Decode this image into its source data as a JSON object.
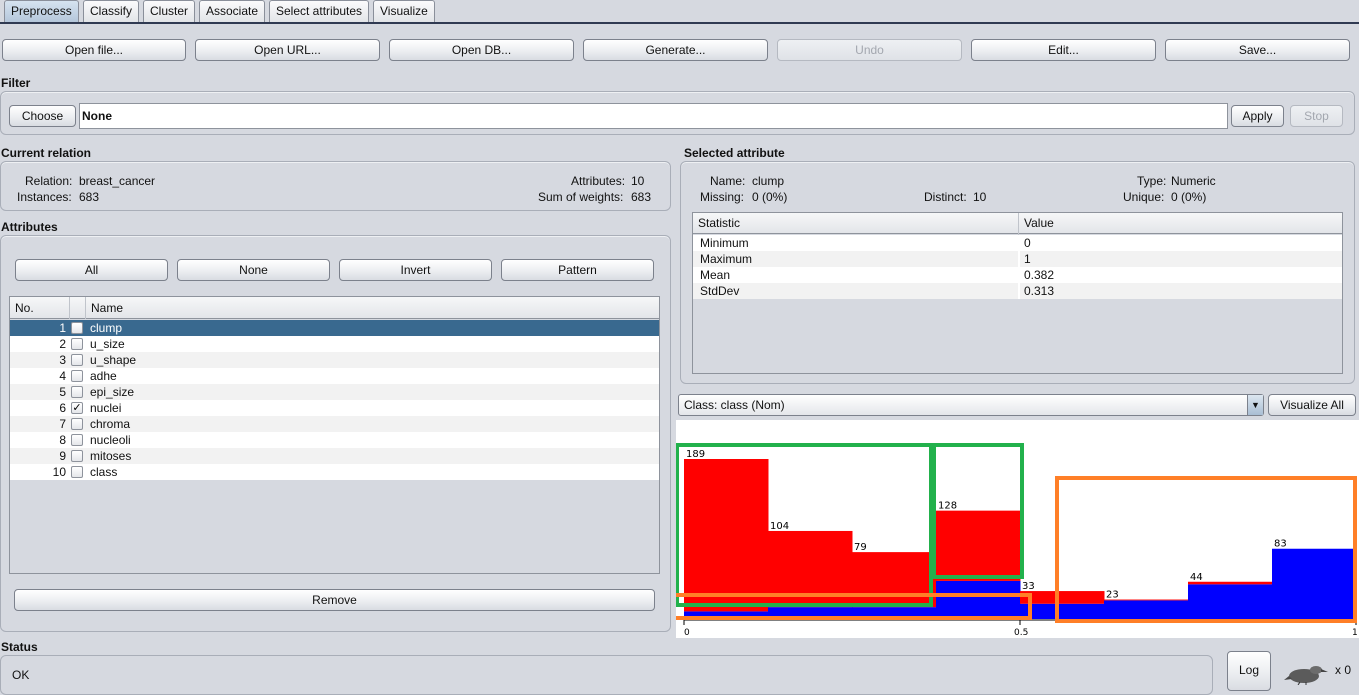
{
  "tabs": [
    "Preprocess",
    "Classify",
    "Cluster",
    "Associate",
    "Select attributes",
    "Visualize"
  ],
  "active_tab": "Preprocess",
  "toolbar": {
    "open_file": "Open file...",
    "open_url": "Open URL...",
    "open_db": "Open DB...",
    "generate": "Generate...",
    "undo": "Undo",
    "edit": "Edit...",
    "save": "Save..."
  },
  "filter": {
    "title": "Filter",
    "choose": "Choose",
    "value": "None",
    "apply": "Apply",
    "stop": "Stop"
  },
  "current_relation": {
    "title": "Current relation",
    "relation_label": "Relation:",
    "relation": "breast_cancer",
    "instances_label": "Instances:",
    "instances": "683",
    "attributes_label": "Attributes:",
    "attributes": "10",
    "sum_weights_label": "Sum of weights:",
    "sum_weights": "683"
  },
  "attributes": {
    "title": "Attributes",
    "buttons": {
      "all": "All",
      "none": "None",
      "invert": "Invert",
      "pattern": "Pattern"
    },
    "col_no": "No.",
    "col_name": "Name",
    "rows": [
      {
        "no": "1",
        "name": "clump",
        "checked": false,
        "selected": true
      },
      {
        "no": "2",
        "name": "u_size",
        "checked": false,
        "selected": false
      },
      {
        "no": "3",
        "name": "u_shape",
        "checked": false,
        "selected": false
      },
      {
        "no": "4",
        "name": "adhe",
        "checked": false,
        "selected": false
      },
      {
        "no": "5",
        "name": "epi_size",
        "checked": false,
        "selected": false
      },
      {
        "no": "6",
        "name": "nuclei",
        "checked": true,
        "selected": false
      },
      {
        "no": "7",
        "name": "chroma",
        "checked": false,
        "selected": false
      },
      {
        "no": "8",
        "name": "nucleoli",
        "checked": false,
        "selected": false
      },
      {
        "no": "9",
        "name": "mitoses",
        "checked": false,
        "selected": false
      },
      {
        "no": "10",
        "name": "class",
        "checked": false,
        "selected": false
      }
    ],
    "remove": "Remove"
  },
  "selected_attribute": {
    "title": "Selected attribute",
    "name_label": "Name:",
    "name": "clump",
    "type_label": "Type:",
    "type": "Numeric",
    "missing_label": "Missing:",
    "missing": "0 (0%)",
    "distinct_label": "Distinct:",
    "distinct": "10",
    "unique_label": "Unique:",
    "unique": "0 (0%)",
    "col_statistic": "Statistic",
    "col_value": "Value",
    "stats": [
      {
        "statistic": "Minimum",
        "value": "0"
      },
      {
        "statistic": "Maximum",
        "value": "1"
      },
      {
        "statistic": "Mean",
        "value": "0.382"
      },
      {
        "statistic": "StdDev",
        "value": "0.313"
      }
    ]
  },
  "class_selector": {
    "value": "Class: class (Nom)",
    "arrow": "▼"
  },
  "visualize_all": "Visualize All",
  "histogram": {
    "colors": {
      "class_a": "#ff0000",
      "class_b": "#0000ff"
    },
    "x_ticks": [
      "0",
      "0.5",
      "1"
    ],
    "bins": [
      {
        "total": 189,
        "red": 180,
        "blue": 9
      },
      {
        "total": 104,
        "red": 90,
        "blue": 14
      },
      {
        "total": 79,
        "red": 65,
        "blue": 14
      },
      {
        "total": 128,
        "red": 83,
        "blue": 45
      },
      {
        "total": 33,
        "red": 15,
        "blue": 18
      },
      {
        "total": 23,
        "red": 1,
        "blue": 22
      },
      {
        "total": 44,
        "red": 3,
        "blue": 41
      },
      {
        "total": 83,
        "red": 0,
        "blue": 83
      }
    ],
    "annotation_colors": {
      "green": "#22b14c",
      "orange": "#ff7f27"
    }
  },
  "status": {
    "title": "Status",
    "text": "OK",
    "log": "Log",
    "count": "x 0"
  }
}
